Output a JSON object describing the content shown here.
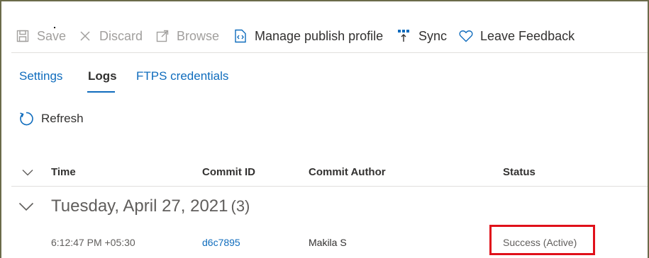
{
  "toolbar": {
    "save_label": "Save",
    "discard_label": "Discard",
    "browse_label": "Browse",
    "manage_publish_profile_label": "Manage publish profile",
    "sync_label": "Sync",
    "leave_feedback_label": "Leave Feedback"
  },
  "tabs": [
    {
      "label": "Settings",
      "active": false
    },
    {
      "label": "Logs",
      "active": true
    },
    {
      "label": "FTPS credentials",
      "active": false
    }
  ],
  "refresh_label": "Refresh",
  "grid": {
    "columns": [
      "Time",
      "Commit ID",
      "Commit Author",
      "Status"
    ],
    "group": {
      "title": "Tuesday, April 27, 2021",
      "count": "(3)"
    },
    "rows": [
      {
        "time": "6:12:47 PM +05:30",
        "commit_id": "d6c7895",
        "author": "Makila S",
        "status": "Success (Active)"
      }
    ]
  },
  "colors": {
    "accent": "#0f6cbd",
    "highlight_box": "#e0101a",
    "disabled_text": "#a19f9d"
  }
}
